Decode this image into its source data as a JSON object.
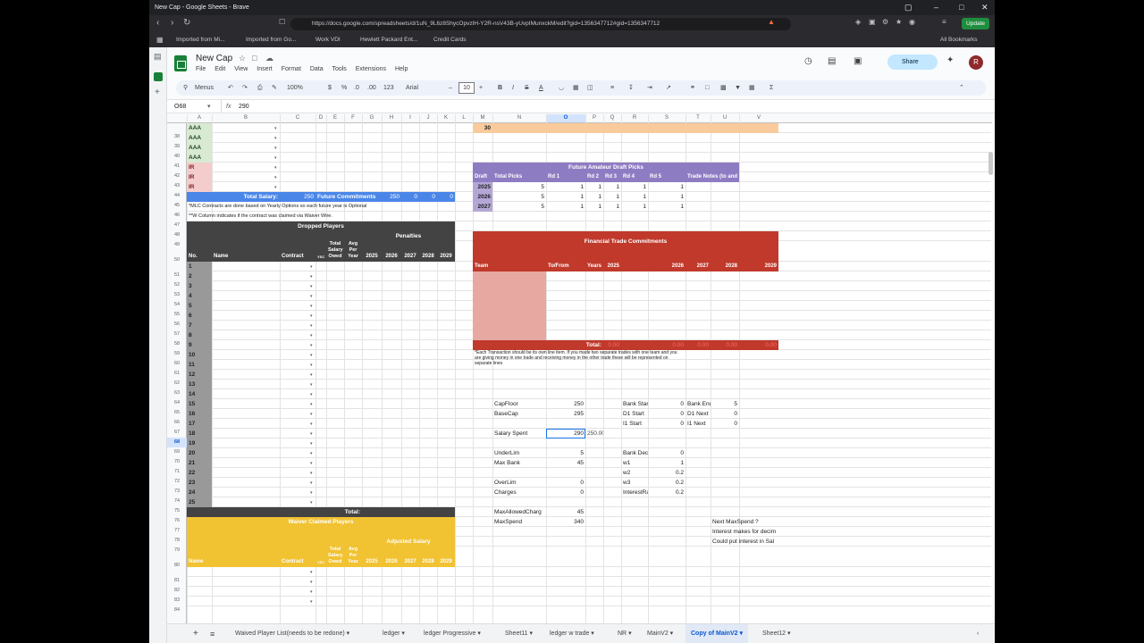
{
  "browser": {
    "title": "New Cap - Google Sheets - Brave",
    "url": "https://docs.google.com/spreadsheets/d/1uN_9L6z8ShycOpvzIH-Y2R-nsV43B-yUvpIMunxckM/edit?gid=1356347712#gid=1356347712",
    "update_label": "Update",
    "bookmarks": [
      "Imported from Mi...",
      "Imported from Go...",
      "Work VDI",
      "Hewlett Packard Ent...",
      "Credit Cards"
    ],
    "all_bookmarks": "All Bookmarks"
  },
  "sheets": {
    "doc_title": "New Cap",
    "menu": [
      "File",
      "Edit",
      "View",
      "Insert",
      "Format",
      "Data",
      "Tools",
      "Extensions",
      "Help"
    ],
    "share_label": "Share",
    "avatar_letter": "R",
    "toolbar": {
      "menus": "Menus",
      "zoom": "100%",
      "currency": "$",
      "percent": "%",
      "dec_dec": ".0",
      "dec_inc": ".00",
      "fmt": "123",
      "font": "Arial",
      "font_size": "10"
    },
    "cell_ref": "O68",
    "formula": "290",
    "columns": [
      "A",
      "B",
      "C",
      "D",
      "E",
      "F",
      "G",
      "H",
      "I",
      "J",
      "K",
      "L",
      "M",
      "N",
      "O",
      "P",
      "Q",
      "R",
      "S",
      "T",
      "U",
      "V"
    ]
  },
  "rows": [
    "38",
    "39",
    "40",
    "41",
    "42",
    "43",
    "44",
    "45",
    "46",
    "47",
    "48",
    "49",
    "50",
    "51",
    "52",
    "53",
    "54",
    "55",
    "56",
    "57",
    "58",
    "59",
    "60",
    "61",
    "62",
    "63",
    "64",
    "65",
    "66",
    "67",
    "68",
    "69",
    "70",
    "71",
    "72",
    "73",
    "74",
    "75",
    "76",
    "77",
    "78",
    "79",
    "80",
    "81",
    "82",
    "83",
    "84"
  ],
  "roster": {
    "aaa": [
      "AAA",
      "AAA",
      "AAA",
      "AAA"
    ],
    "ir": [
      "IR",
      "IR",
      "IR"
    ],
    "total_salary_label": "Total Salary:",
    "total_salary_value": "250",
    "future_commitment_label": "Future Commitments",
    "future_values": [
      "250",
      "0",
      "0",
      "0"
    ],
    "note1": "*MLC Contracts are done based on Yearly Options so each future year is Optional",
    "note2": "**W Column indicates if the contract was claimed via Waiver Wire."
  },
  "dropped": {
    "title": "Dropped Players",
    "penalties": "Penalties",
    "headers": {
      "no": "No.",
      "name": "Name",
      "contract": "Contract",
      "ysc": "YSC",
      "owed": "Total Salary Owed",
      "avg": "Avg Per Year",
      "y2025": "2025",
      "y2026": "2026",
      "y2027": "2027",
      "y2028": "2028",
      "y2029": "2029"
    },
    "numbers": [
      "1",
      "2",
      "3",
      "4",
      "5",
      "6",
      "7",
      "8",
      "9",
      "10",
      "11",
      "12",
      "13",
      "14",
      "15",
      "16",
      "17",
      "18",
      "19",
      "20",
      "21",
      "22",
      "23",
      "24",
      "25"
    ],
    "total_label": "Total:"
  },
  "waiver": {
    "title": "Waiver Claimed Players",
    "adjusted": "Adjusted Salary",
    "headers": {
      "name": "Name",
      "contract": "Contract",
      "ysc": "YSC",
      "owed": "Total Salary Owed",
      "avg": "Avg Per Year",
      "y2025": "2025",
      "y2026": "2026",
      "y2027": "2027",
      "y2028": "2028",
      "y2029": "2029"
    }
  },
  "m38_value": "30",
  "draft": {
    "title": "Future Amateur Draft Picks",
    "headers": [
      "Draft",
      "Total Picks",
      "Rd 1",
      "Rd 2",
      "Rd 3",
      "Rd 4",
      "Rd 5",
      "Trade Notes (to and From)"
    ],
    "rows": [
      {
        "year": "2025",
        "total": "5",
        "r1": "1",
        "r2": "1",
        "r3": "1",
        "r4": "1",
        "r5": "1"
      },
      {
        "year": "2026",
        "total": "5",
        "r1": "1",
        "r2": "1",
        "r3": "1",
        "r4": "1",
        "r5": "1"
      },
      {
        "year": "2027",
        "total": "5",
        "r1": "1",
        "r2": "1",
        "r3": "1",
        "r4": "1",
        "r5": "1"
      }
    ]
  },
  "financial": {
    "title": "Financial Trade Commitments",
    "headers": [
      "Team",
      "To/From",
      "Years",
      "2025",
      "2026",
      "2027",
      "2028",
      "2029"
    ],
    "total_label": "Total:",
    "total_values": [
      "0.00",
      "0.00",
      "0.00",
      "0.00",
      "0.00"
    ],
    "note": "*Each Transaction should be its own line item. If you made two separate trades with one team and you are giving money in one trade and receiving money in the other trade these will be represented on separate lines"
  },
  "cap": {
    "capfloor_label": "CapFloor",
    "capfloor": "250",
    "basecap_label": "BaseCap",
    "basecap": "295",
    "salary_spent_label": "Salary Spent",
    "salary_spent": "290",
    "salary_spent_extra": "250.00",
    "underlim_label": "UnderLim",
    "underlim": "5",
    "maxbank_label": "Max Bank",
    "maxbank": "45",
    "overlim_label": "OverLim",
    "overlim": "0",
    "charges_label": "Charges",
    "charges": "0",
    "maxallowed_label": "MaxAllowedCharg",
    "maxallowed": "45",
    "maxspend_label": "MaxSpend",
    "maxspend": "340",
    "bankstart_label": "Bank Start",
    "bankstart": "0",
    "d1start_label": "D1 Start",
    "d1start": "0",
    "i1start_label": "I1 Start",
    "i1start": "0",
    "bankdecr_label": "Bank Decr",
    "bankdecr": "0",
    "w1_label": "w1",
    "w1": "1",
    "w2_label": "w2",
    "w2": "0.2",
    "w3_label": "w3",
    "w3": "0.2",
    "interest_label": "InterestRa",
    "interest": "0.2",
    "bankend_label": "Bank End",
    "bankend": "5",
    "d1next_label": "D1 Next",
    "d1next": "0",
    "i1next_label": "I1 Next",
    "i1next": "0",
    "note1": "Next MaxSpend ?",
    "note2": "Interest makes for decim",
    "note3": "Could put interest in Sal"
  },
  "tabs": [
    "Waived Player List(needs to be redone)",
    "ledger",
    "ledger Progressive",
    "Sheet11",
    "ledger w trade",
    "NR",
    "MainV2",
    "Copy of MainV2",
    "Sheet12"
  ],
  "colors": {
    "green": "#d9ead3",
    "pink": "#f4cccc",
    "blue": "#4a86e8",
    "gray_dark": "#434343",
    "gray": "#999999",
    "purple": "#8e7cc3",
    "red": "#c0392b",
    "yellow": "#f1c232",
    "orange": "#f9cb9c",
    "salmon": "#e6a8a1"
  }
}
